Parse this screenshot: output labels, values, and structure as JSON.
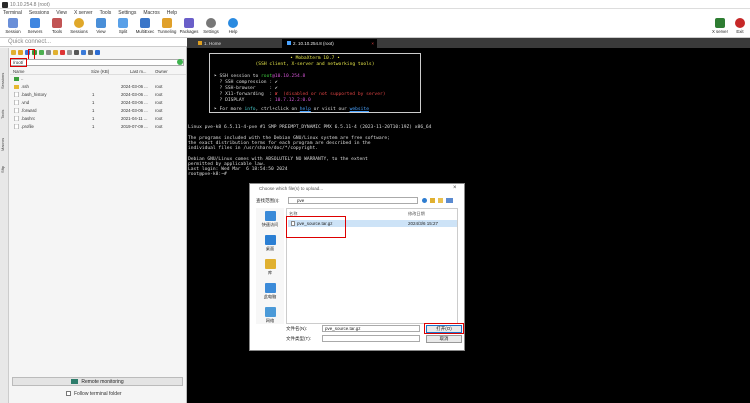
{
  "window": {
    "title": "10.10.254.8 (root)"
  },
  "menu": [
    "Terminal",
    "Sessions",
    "View",
    "X server",
    "Tools",
    "Settings",
    "Macros",
    "Help"
  ],
  "toolbar": {
    "items": [
      {
        "label": "Session",
        "color": "#6a8fd8"
      },
      {
        "label": "Servers",
        "color": "#3f86e0"
      },
      {
        "label": "Tools",
        "color": "#c25454"
      },
      {
        "label": "Sessions",
        "color": "#e0a82a"
      },
      {
        "label": "View",
        "color": "#4a8fd8"
      },
      {
        "label": "Split",
        "color": "#59a0e8"
      },
      {
        "label": "MultiExec",
        "color": "#3a76c9"
      },
      {
        "label": "Tunneling",
        "color": "#e0a02a"
      },
      {
        "label": "Packages",
        "color": "#6a5fc9"
      },
      {
        "label": "Settings",
        "color": "#777777"
      },
      {
        "label": "Help",
        "color": "#2a8ae0"
      }
    ],
    "xserver_label": "X server",
    "exit_label": "Exit"
  },
  "sidebar": {
    "quick_connect": "Quick connect...",
    "vertical_tabs": [
      "Sessions",
      "Tools",
      "Macros",
      "Sftp"
    ],
    "path": "/root/",
    "columns": {
      "name": "Name",
      "size": "Size (KB)",
      "modified": "Last m...",
      "owner": "Owner"
    },
    "files": [
      {
        "name": "..",
        "size": "",
        "modified": "",
        "owner": ""
      },
      {
        "name": ".ssh",
        "size": "",
        "modified": "2024-03-06 ...",
        "owner": "root"
      },
      {
        "name": ".bash_history",
        "size": "1",
        "modified": "2024-03-06 ...",
        "owner": "root"
      },
      {
        "name": ".vnd",
        "size": "1",
        "modified": "2024-03-06 ...",
        "owner": "root"
      },
      {
        "name": ".forward",
        "size": "1",
        "modified": "2024-03-06 ...",
        "owner": "root"
      },
      {
        "name": ".bashrc",
        "size": "1",
        "modified": "2021-04-11 ...",
        "owner": "root"
      },
      {
        "name": ".profile",
        "size": "1",
        "modified": "2019-07-09 ...",
        "owner": "root"
      }
    ],
    "remote_monitoring": "Remote monitoring",
    "follow_terminal": "Follow terminal folder"
  },
  "tabs": [
    {
      "label": "1. Home"
    },
    {
      "label": "2. 10.10.254.8 (root)"
    }
  ],
  "terminal": {
    "banner_title": "• MobaXterm 10.7 •",
    "banner_sub": "(SSH client, X-server and networking tools)",
    "session_prefix": "➤ SSH session to ",
    "session_user": "root",
    "session_host": "@10.10.254.8",
    "compression": "  ? SSH compression : ✔",
    "browser": "  ? SSH-browser     : ✔",
    "x11_prefix": "  ? X11-forwarding  : ",
    "x11_value": "✘  (disabled or not supported by server)",
    "display_prefix": "  ? DISPLAY         : ",
    "display_value": "10.7.12.2:0.0",
    "info_1": "➤ For more ",
    "info_link": "info",
    "info_2": ", ctrl+click on ",
    "help_link": "help",
    "info_3": " or visit our ",
    "web_link": "website",
    "lines": [
      "Linux pve-k8 6.5.11-4-pve #1 SMP PREEMPT_DYNAMIC PMX 6.5.11-4 (2023-11-20T10:19Z) x86_64",
      "",
      "The programs included with the Debian GNU/Linux system are free software;",
      "the exact distribution terms for each program are described in the",
      "individual files in /usr/share/doc/*/copyright.",
      "",
      "Debian GNU/Linux comes with ABSOLUTELY NO WARRANTY, to the extent",
      "permitted by applicable law.",
      "Last login: Wed Mar  6 18:54:50 2024",
      "root@pve-k8:~# "
    ]
  },
  "dialog": {
    "title": "Choose which file(s) to upload...",
    "close": "×",
    "look_in_label": "查找范围(I):",
    "look_in_value": "pve",
    "nav": [
      "快速访问",
      "桌面",
      "库",
      "此电脑",
      "网络"
    ],
    "col_name": "名称",
    "col_date": "修改日期",
    "file_name": "pve_source.tar.gz",
    "file_date": "2024/3/6 15:27",
    "filename_label": "文件名(N):",
    "filename_value": "pve_source.tar.gz",
    "filetype_label": "文件类型(T):",
    "open_btn": "打开(O)",
    "cancel_btn": "取消"
  }
}
